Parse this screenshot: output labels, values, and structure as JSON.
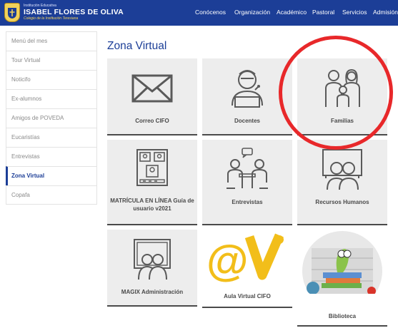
{
  "header": {
    "small": "Institución Educativa",
    "name": "ISABEL FLORES DE OLIVA",
    "sub": "Colegio de la Institución Teresiana",
    "nav": [
      "Conócenos",
      "Organización",
      "Académico",
      "Pastoral",
      "Servicios",
      "Admisión"
    ]
  },
  "sidebar": {
    "items": [
      {
        "label": "Menú del mes"
      },
      {
        "label": "Tour Virtual"
      },
      {
        "label": "Noticifo"
      },
      {
        "label": "Ex-alumnos"
      },
      {
        "label": "Amigos de POVEDA"
      },
      {
        "label": "Eucaristías"
      },
      {
        "label": "Entrevistas"
      },
      {
        "label": "Zona Virtual"
      },
      {
        "label": "Copafa"
      }
    ],
    "active_label": "Zona Virtual"
  },
  "main": {
    "title": "Zona Virtual",
    "tiles": [
      {
        "label": "Correo CIFO",
        "icon": "envelope-icon"
      },
      {
        "label": "Docentes",
        "icon": "teacher-icon"
      },
      {
        "label": "Familias",
        "icon": "family-icon"
      },
      {
        "label": "MATRÍCULA EN LÍNEA Guía de usuario v2021",
        "icon": "enrollment-icon"
      },
      {
        "label": "Entrevistas",
        "icon": "meeting-icon"
      },
      {
        "label": "Recursos Humanos",
        "icon": "presentation-icon"
      },
      {
        "label": "MAGIX Administración",
        "icon": "board-icon"
      },
      {
        "label": "Aula Virtual CIFO",
        "icon": "aula-virtual-logo",
        "logo_text": "@V"
      },
      {
        "label": "Biblioteca",
        "icon": "library-icon"
      }
    ]
  },
  "colors": {
    "header_bg": "#1c3e97",
    "tile_bg": "#ededed",
    "accent_yellow": "#f2be1a",
    "annotation_red": "#e8282a"
  }
}
